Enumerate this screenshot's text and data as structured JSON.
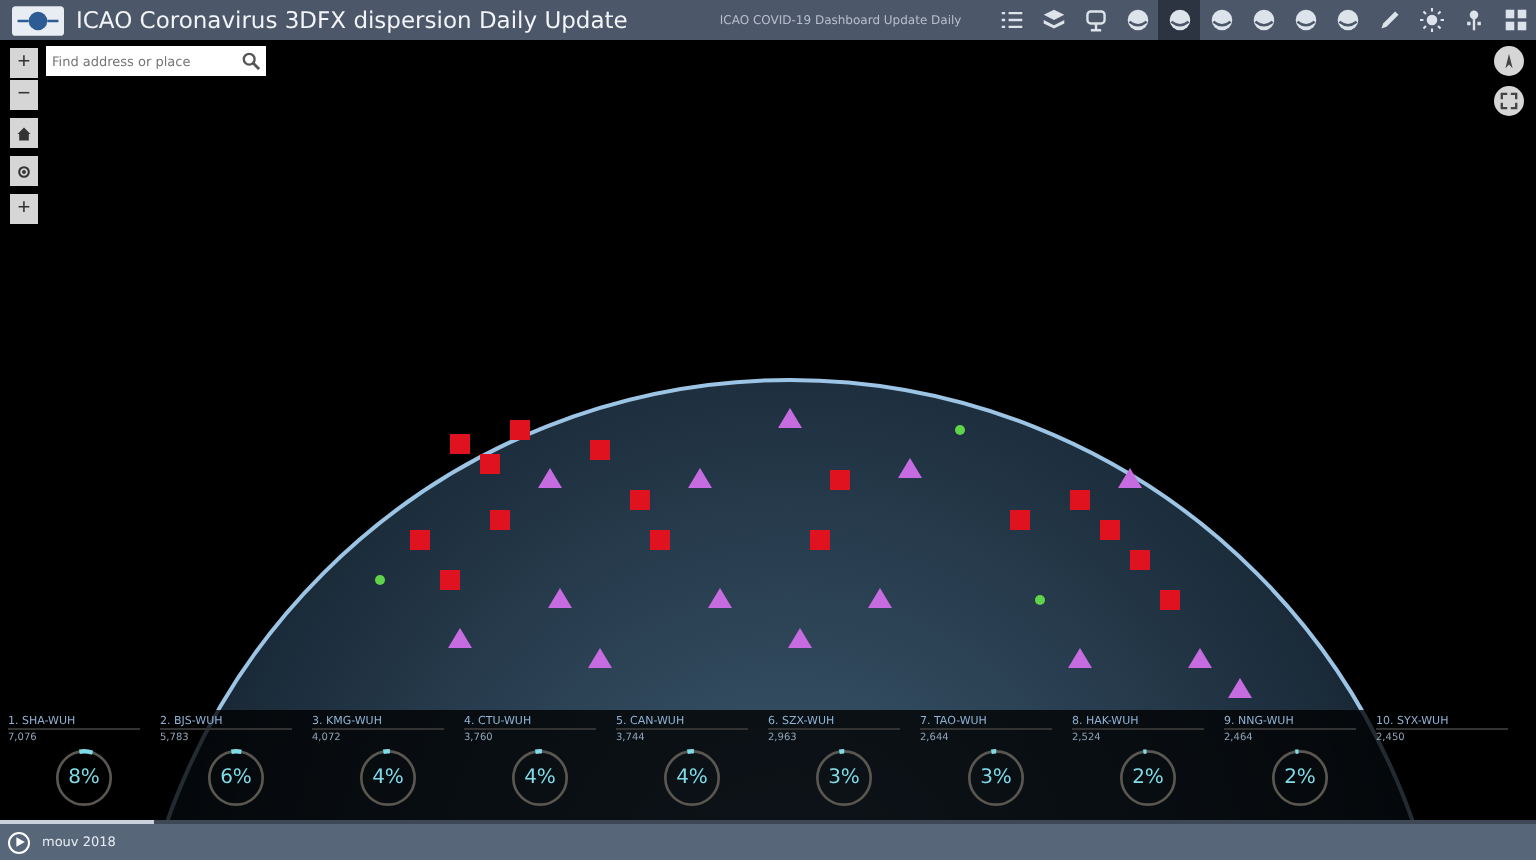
{
  "header": {
    "title": "ICAO Coronavirus 3DFX dispersion Daily Update",
    "subtitle": "ICAO COVID-19 Dashboard Update Daily",
    "tools": [
      {
        "kind": "list",
        "selected": false
      },
      {
        "kind": "layers",
        "selected": false
      },
      {
        "kind": "monitor",
        "selected": false
      },
      {
        "kind": "globe",
        "selected": false
      },
      {
        "kind": "globe",
        "selected": true
      },
      {
        "kind": "globe",
        "selected": false
      },
      {
        "kind": "globe",
        "selected": false
      },
      {
        "kind": "globe",
        "selected": false
      },
      {
        "kind": "globe",
        "selected": false
      },
      {
        "kind": "pencil",
        "selected": false
      },
      {
        "kind": "sun",
        "selected": false
      },
      {
        "kind": "pin",
        "selected": false
      },
      {
        "kind": "grid",
        "selected": false
      }
    ]
  },
  "map_controls": {
    "zoom_in": "+",
    "zoom_out": "−",
    "extra": "+"
  },
  "search": {
    "placeholder": "Find address or place"
  },
  "routes": [
    {
      "label": "1. SHA-WUH",
      "count": "7,076",
      "percent": "8%",
      "level": 0.08
    },
    {
      "label": "2. BJS-WUH",
      "count": "5,783",
      "percent": "6%",
      "level": 0.06
    },
    {
      "label": "3. KMG-WUH",
      "count": "4,072",
      "percent": "4%",
      "level": 0.04
    },
    {
      "label": "4. CTU-WUH",
      "count": "3,760",
      "percent": "4%",
      "level": 0.04
    },
    {
      "label": "5. CAN-WUH",
      "count": "3,744",
      "percent": "4%",
      "level": 0.04
    },
    {
      "label": "6. SZX-WUH",
      "count": "2,963",
      "percent": "3%",
      "level": 0.03
    },
    {
      "label": "7. TAO-WUH",
      "count": "2,644",
      "percent": "3%",
      "level": 0.03
    },
    {
      "label": "8. HAK-WUH",
      "count": "2,524",
      "percent": "2%",
      "level": 0.02
    },
    {
      "label": "9. NNG-WUH",
      "count": "2,464",
      "percent": "2%",
      "level": 0.02
    },
    {
      "label": "10. SYX-WUH",
      "count": "2,450"
    }
  ],
  "timeline": {
    "label": "mouv 2018",
    "level": 0.1
  }
}
